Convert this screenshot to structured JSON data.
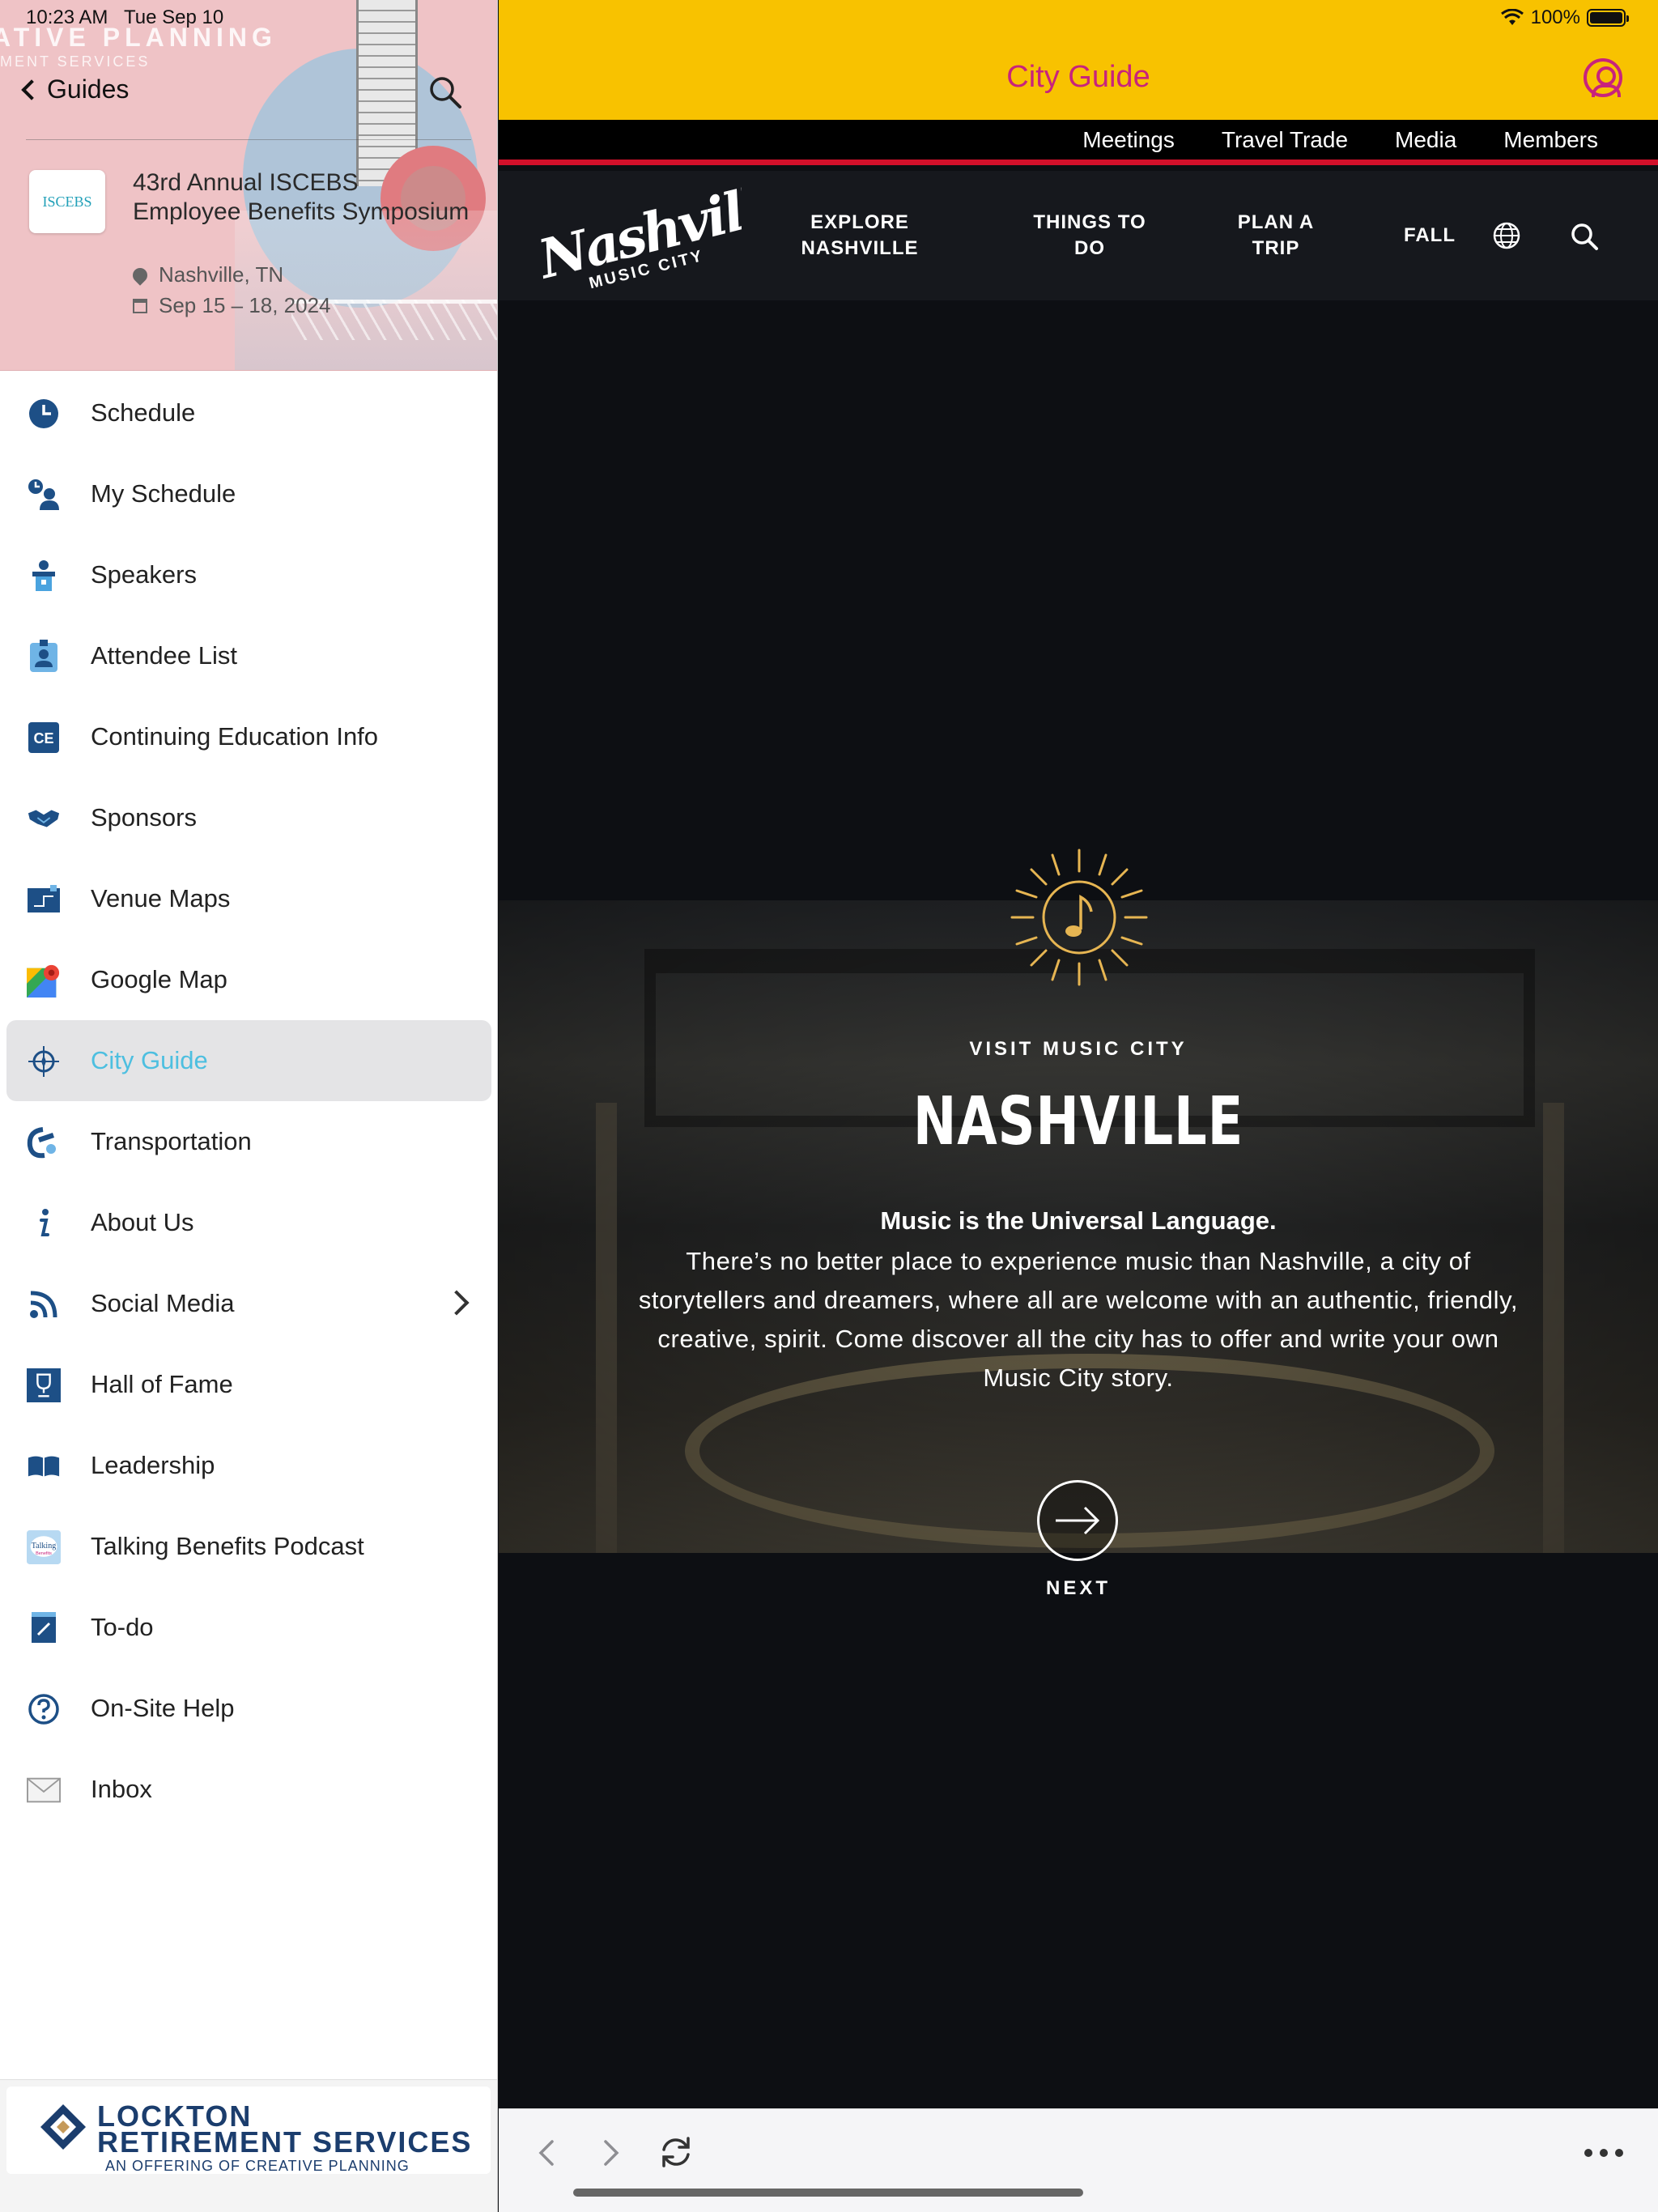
{
  "status_bar": {
    "time": "10:23 AM",
    "date": "Tue Sep 10",
    "battery": "100%",
    "battery_level": 1.0
  },
  "sidebar": {
    "banner_text": "ATIVE PLANNING",
    "banner_sub": "MENT SERVICES",
    "back_label": "Guides",
    "event": {
      "logo_text": "ISCEBS",
      "title": "43rd Annual ISCEBS Employee Benefits Symposium",
      "location": "Nashville, TN",
      "dates": "Sep 15 – 18, 2024"
    },
    "items": [
      {
        "label": "Schedule",
        "icon": "clock-icon"
      },
      {
        "label": "My Schedule",
        "icon": "person-clock-icon"
      },
      {
        "label": "Speakers",
        "icon": "podium-icon"
      },
      {
        "label": "Attendee List",
        "icon": "badge-icon"
      },
      {
        "label": "Continuing Education Info",
        "icon": "ce-icon"
      },
      {
        "label": "Sponsors",
        "icon": "handshake-icon"
      },
      {
        "label": "Venue Maps",
        "icon": "floor-map-icon"
      },
      {
        "label": "Google Map",
        "icon": "google-map-icon"
      },
      {
        "label": "City Guide",
        "icon": "compass-icon",
        "active": true
      },
      {
        "label": "Transportation",
        "icon": "transport-icon"
      },
      {
        "label": "About Us",
        "icon": "info-icon"
      },
      {
        "label": "Social Media",
        "icon": "rss-icon",
        "has_submenu": true
      },
      {
        "label": "Hall of Fame",
        "icon": "trophy-icon"
      },
      {
        "label": "Leadership",
        "icon": "book-icon"
      },
      {
        "label": "Talking Benefits Podcast",
        "icon": "podcast-icon"
      },
      {
        "label": "To-do",
        "icon": "todo-icon"
      },
      {
        "label": "On-Site Help",
        "icon": "help-icon"
      },
      {
        "label": "Inbox",
        "icon": "envelope-icon"
      }
    ],
    "footer": {
      "line1": "LOCKTON",
      "line2": "RETIREMENT SERVICES",
      "line3": "AN OFFERING OF CREATIVE PLANNING"
    }
  },
  "main": {
    "title": "City Guide",
    "utility_nav": [
      "Meetings",
      "Travel Trade",
      "Media",
      "Members"
    ],
    "site_nav": {
      "logo_text": "Nashville",
      "logo_sub": "MUSIC CITY",
      "links": [
        {
          "line1": "EXPLORE",
          "line2": "NASHVILLE"
        },
        {
          "line1": "THINGS TO",
          "line2": "DO"
        },
        {
          "line1": "PLAN A",
          "line2": "TRIP"
        },
        {
          "line1": "FALL",
          "line2": ""
        }
      ]
    },
    "hero": {
      "eyebrow": "VISIT MUSIC CITY",
      "title": "NASHVILLE",
      "tagline": "Music is the Universal Language.",
      "body": "There’s no better place to experience music than Nashville, a city of storytellers and dreamers, where all are welcome with an authentic, friendly, creative, spirit. Come discover all the city has to offer and write your own Music City story.",
      "next_label": "NEXT"
    }
  },
  "colors": {
    "header_yellow": "#f8c200",
    "accent_magenta": "#c8237c",
    "active_blue": "#4dbfe0",
    "nav_red": "#d2102a",
    "icon_navy": "#1d4f86"
  }
}
